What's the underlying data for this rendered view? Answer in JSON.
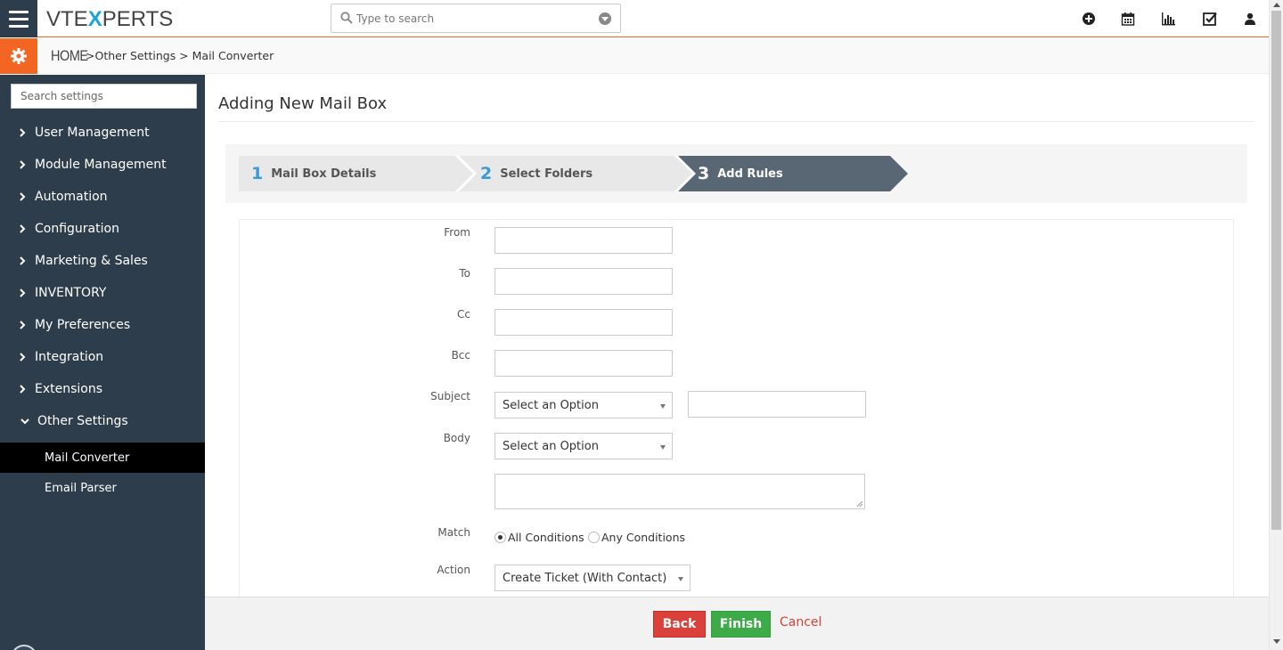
{
  "header": {
    "logo_prefix": "VTE",
    "logo_x": "X",
    "logo_suffix": "PERTS",
    "search_placeholder": "Type to search",
    "icons": [
      "plus-circle-icon",
      "calendar-icon",
      "bar-chart-icon",
      "checkbox-icon",
      "user-icon"
    ]
  },
  "breadcrumb": {
    "home": "HOME",
    "rest": ">Other Settings >  Mail Converter"
  },
  "sidebar": {
    "search_placeholder": "Search settings",
    "items": [
      {
        "label": "User Management",
        "expanded": false
      },
      {
        "label": "Module Management",
        "expanded": false
      },
      {
        "label": "Automation",
        "expanded": false
      },
      {
        "label": "Configuration",
        "expanded": false
      },
      {
        "label": "Marketing & Sales",
        "expanded": false
      },
      {
        "label": "INVENTORY",
        "expanded": false
      },
      {
        "label": "My Preferences",
        "expanded": false
      },
      {
        "label": "Integration",
        "expanded": false
      },
      {
        "label": "Extensions",
        "expanded": false
      },
      {
        "label": "Other Settings",
        "expanded": true
      }
    ],
    "sub_items": [
      {
        "label": "Mail Converter",
        "active": true
      },
      {
        "label": "Email Parser",
        "active": false
      }
    ]
  },
  "main": {
    "title": "Adding New Mail Box",
    "steps": [
      {
        "num": "1",
        "label": "Mail Box Details",
        "active": false
      },
      {
        "num": "2",
        "label": "Select Folders",
        "active": false
      },
      {
        "num": "3",
        "label": "Add Rules",
        "active": true
      }
    ],
    "form": {
      "from_label": "From",
      "to_label": "To",
      "cc_label": "Cc",
      "bcc_label": "Bcc",
      "subject_label": "Subject",
      "subject_select": "Select an Option",
      "body_label": "Body",
      "body_select": "Select an Option",
      "match_label": "Match",
      "match_all": "All Conditions",
      "match_any": "Any Conditions",
      "action_label": "Action",
      "action_select": "Create Ticket (With Contact)"
    }
  },
  "footer": {
    "back_label": "Back",
    "finish_label": "Finish",
    "cancel_label": "Cancel"
  },
  "colors": {
    "accent_orange": "#f26522",
    "sidebar_bg": "#2e3d4c",
    "step_active": "#596674",
    "step_inactive": "#e8e8e8",
    "step_num": "#3a9ad9",
    "back_red": "#d9413a",
    "finish_green": "#3dab47"
  }
}
